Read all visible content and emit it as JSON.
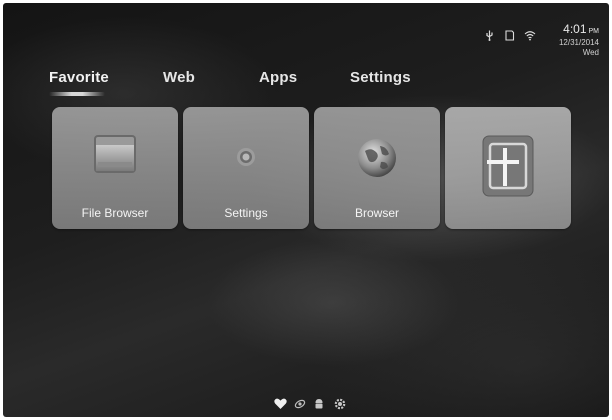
{
  "status_bar": {
    "icons": [
      "usb-icon",
      "sd-card-icon",
      "wifi-icon"
    ],
    "time": "4:01",
    "ampm": "PM",
    "date": "12/31/2014",
    "weekday": "Wed"
  },
  "tabs": [
    {
      "label": "Favorite",
      "active": true
    },
    {
      "label": "Web",
      "active": false
    },
    {
      "label": "Apps",
      "active": false
    },
    {
      "label": "Settings",
      "active": false
    }
  ],
  "tiles": [
    {
      "label": "File Browser",
      "icon": "folder-icon"
    },
    {
      "label": "Settings",
      "icon": "gear-icon"
    },
    {
      "label": "Browser",
      "icon": "globe-icon"
    },
    {
      "label": "",
      "icon": "add-icon"
    }
  ],
  "dock": {
    "icons": [
      "heart-icon",
      "satellite-icon",
      "android-icon",
      "gear-icon"
    ]
  }
}
